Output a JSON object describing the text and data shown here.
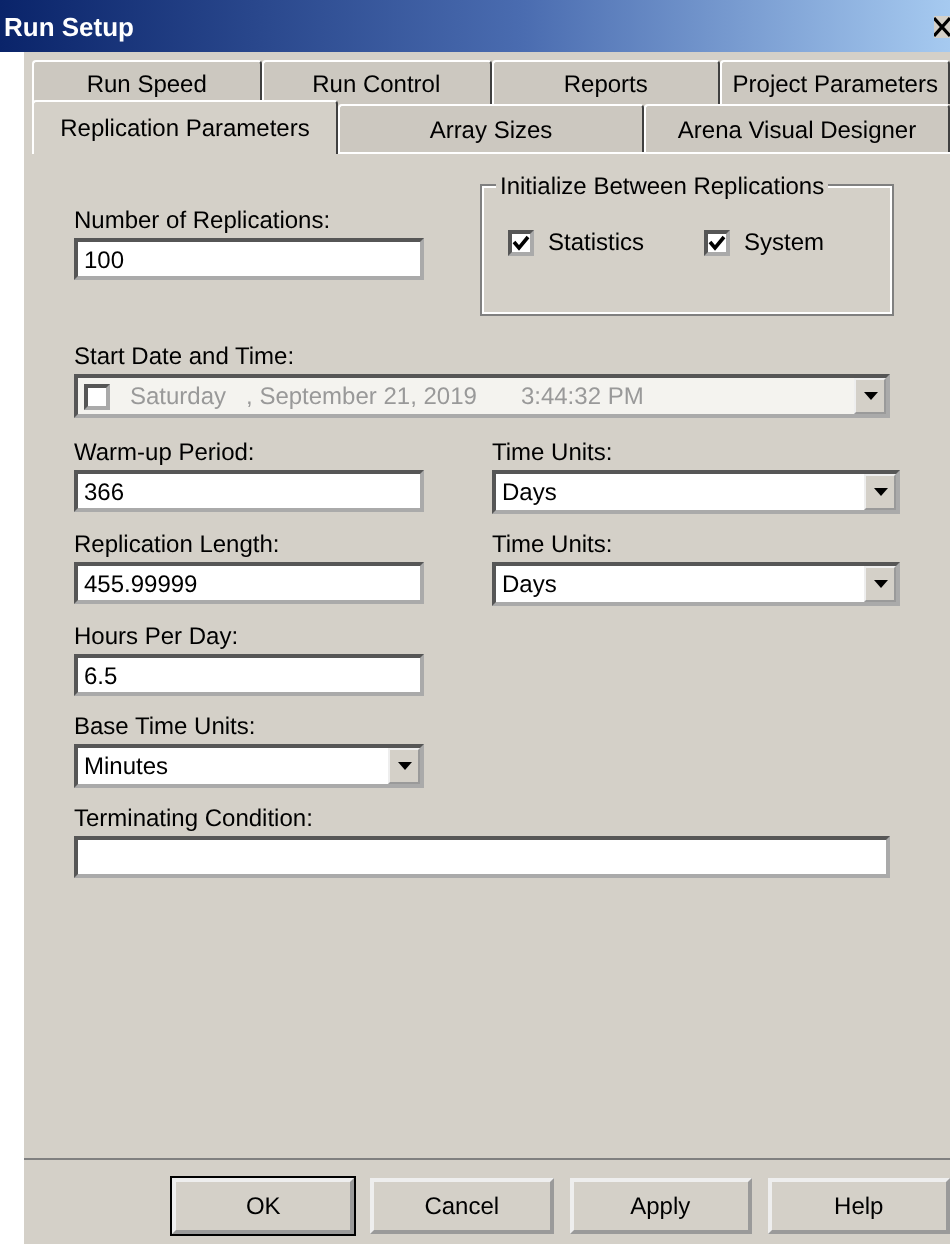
{
  "window": {
    "title": "Run Setup"
  },
  "tab_rows": [
    [
      {
        "label": "Run Speed",
        "selected": false
      },
      {
        "label": "Run Control",
        "selected": false
      },
      {
        "label": "Reports",
        "selected": false
      },
      {
        "label": "Project Parameters",
        "selected": false
      }
    ],
    [
      {
        "label": "Replication Parameters",
        "selected": true
      },
      {
        "label": "Array Sizes",
        "selected": false
      },
      {
        "label": "Arena Visual Designer",
        "selected": false
      }
    ]
  ],
  "replications": {
    "label": "Number of Replications:",
    "value": "100"
  },
  "initialize_group": {
    "title": "Initialize Between Replications",
    "options": [
      {
        "label": "Statistics",
        "checked": true
      },
      {
        "label": "System",
        "checked": true
      }
    ]
  },
  "start_date": {
    "label": "Start Date and Time:",
    "checked": false,
    "disabled": true,
    "day": "Saturday",
    "date": ", September 21, 2019",
    "time": "3:44:32 PM"
  },
  "warmup": {
    "label": "Warm-up Period:",
    "value": "366",
    "units_label": "Time Units:",
    "units": "Days"
  },
  "replication_length": {
    "label": "Replication Length:",
    "value": "455.99999",
    "units_label": "Time Units:",
    "units": "Days"
  },
  "hours_per_day": {
    "label": "Hours Per Day:",
    "value": "6.5"
  },
  "base_time_units": {
    "label": "Base Time Units:",
    "value": "Minutes"
  },
  "terminating_condition": {
    "label": "Terminating Condition:"
  },
  "buttons": [
    {
      "label": "OK",
      "default": true
    },
    {
      "label": "Cancel",
      "default": false
    },
    {
      "label": "Apply",
      "default": false
    },
    {
      "label": "Help",
      "default": false
    }
  ]
}
